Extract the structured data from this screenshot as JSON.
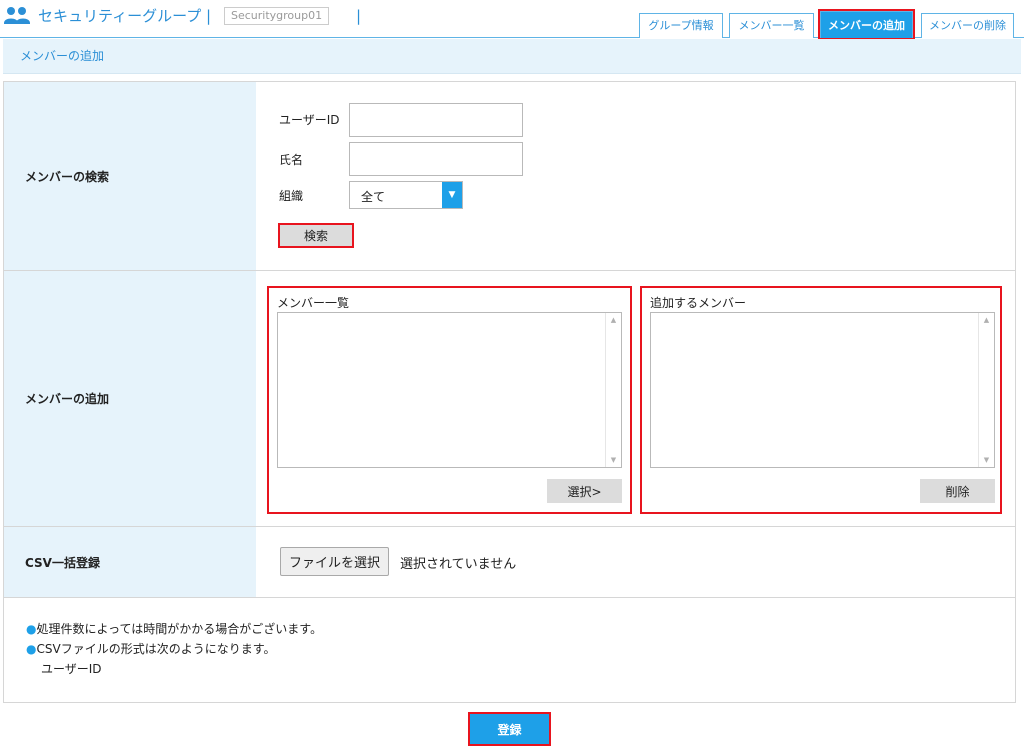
{
  "header": {
    "title": "セキュリティーグループ",
    "separator": "|",
    "group_name": "Securitygroup01"
  },
  "tabs": [
    {
      "label": "グループ情報",
      "active": false
    },
    {
      "label": "メンバー一覧",
      "active": false
    },
    {
      "label": "メンバーの追加",
      "active": true
    },
    {
      "label": "メンバーの削除",
      "active": false
    }
  ],
  "section_title": "メンバーの追加",
  "search": {
    "label": "メンバーの検索",
    "user_id_label": "ユーザーID",
    "user_id_value": "",
    "name_label": "氏名",
    "name_value": "",
    "org_label": "組織",
    "org_value": "全て",
    "button": "検索"
  },
  "add": {
    "label": "メンバーの追加",
    "member_list_title": "メンバー一覧",
    "select_button": "選択>",
    "to_add_title": "追加するメンバー",
    "delete_button": "削除"
  },
  "csv": {
    "label": "CSV一括登録",
    "file_button": "ファイルを選択",
    "file_status": "選択されていません"
  },
  "notes": {
    "line1": "処理件数によっては時間がかかる場合がございます。",
    "line2": "CSVファイルの形式は次のようになります。",
    "line3": "ユーザーID",
    "bullet": "●"
  },
  "submit": "登録",
  "colors": {
    "accent": "#1ea0e8",
    "highlight": "#e8141e",
    "label_bg": "#e6f3fb"
  }
}
